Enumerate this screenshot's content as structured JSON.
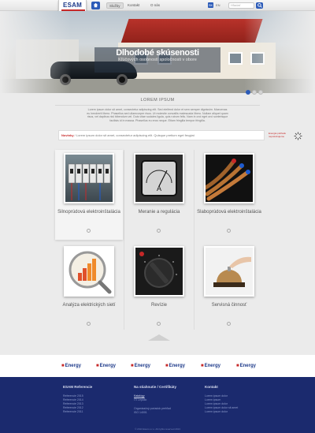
{
  "header": {
    "logo_text": "ESAM",
    "nav": [
      "Služby",
      "Kontakt",
      "O nás"
    ],
    "lang": [
      "SK",
      "EN"
    ],
    "search_placeholder": "Hľadať"
  },
  "hero": {
    "title": "Dlhodobé skúsenosti",
    "subtitle": "Kľúčových osobností spoločnosti v obore"
  },
  "intro": {
    "title": "LOREM IPSUM",
    "text": "Lorem ipsum dolor sit amet, consectetur adipiscing elit. Sed eleifend dolor et sem semper dignissim. Maecenas eu hendrerit libero. Phasellus sed ullamcorper risus. Ut molestie convallis malesuada libero. Nullam aliquet quam risus, vel dapibus nisl bibendum vel. Duis vitae sodales ligula, quis rutrum felis. Nam in orci eget orci scelerisque facilisis id in massa. Phasellus eu eros neque. Etiam fringilla tempor fringilla."
  },
  "notice": {
    "label": "Novinky",
    "text": " / Lorem ipsum dolor sit amet, consectetur adipiscing elit. Quisque pretium eget feugiat",
    "icon_label": "Energia pohľadu nepotrebujeme"
  },
  "tiles": [
    {
      "label": "Silnoprúdová elektroinštalácia"
    },
    {
      "label": "Meranie a regulácia"
    },
    {
      "label": "Slaboprúdová elektroinštalácia"
    },
    {
      "label": "Analýza elektrických sietí"
    },
    {
      "label": "Revízie"
    },
    {
      "label": "Servisná činnosť"
    }
  ],
  "brands": [
    "Energy",
    "Energy",
    "Energy",
    "Energy",
    "Energy",
    "Energy"
  ],
  "footer": {
    "col1": {
      "title": "ESAM Referencie",
      "links": [
        "Referencie 2015",
        "Referencie 2014",
        "Referencie 2013",
        "Referencie 2012",
        "Referencie 2011"
      ]
    },
    "col2": {
      "title": "Na stiahnutie / Certifikáty",
      "links": [
        "Katalógy",
        "ITI Lepidlo",
        "Organizačný poriadok prehľad",
        "ISO 14001"
      ]
    },
    "col3": {
      "title": "Kontakt",
      "links": [
        "Lorem ipsum dolor",
        "Lorem ipsum",
        "Lorem ipsum dolor",
        "Lorem ipsum dolor sit amet",
        "Lorem ipsum dolor"
      ]
    },
    "copyright": "© 2013 Esam s.r.o. All rights reserved 2013"
  },
  "colors": {
    "accent": "#2c5bb8",
    "brand_red": "#c62828",
    "footer_bg": "#1b2a6e"
  }
}
